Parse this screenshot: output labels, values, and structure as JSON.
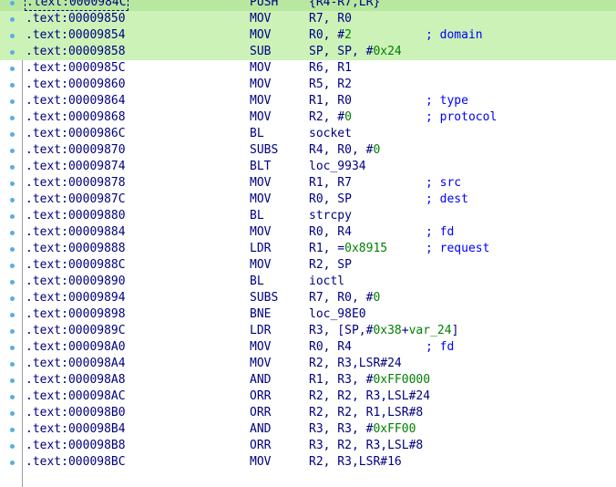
{
  "lines": [
    {
      "addr": ".text:0000984C",
      "mn": "PUSH",
      "ops": [
        {
          "t": "{R4-R7,LR}"
        }
      ],
      "cmt": "",
      "hl": "top",
      "sel": true
    },
    {
      "addr": ".text:00009850",
      "mn": "MOV",
      "ops": [
        {
          "t": "R7, R0"
        }
      ],
      "cmt": "",
      "hl": "yes"
    },
    {
      "addr": ".text:00009854",
      "mn": "MOV",
      "ops": [
        {
          "t": "R0, #"
        },
        {
          "t": "2",
          "n": true
        }
      ],
      "cmt": "; domain",
      "hl": "yes"
    },
    {
      "addr": ".text:00009858",
      "mn": "SUB",
      "ops": [
        {
          "t": "SP, SP, #"
        },
        {
          "t": "0x24",
          "n": true
        }
      ],
      "cmt": "",
      "hl": "yes"
    },
    {
      "addr": ".text:0000985C",
      "mn": "MOV",
      "ops": [
        {
          "t": "R6, R1"
        }
      ],
      "cmt": ""
    },
    {
      "addr": ".text:00009860",
      "mn": "MOV",
      "ops": [
        {
          "t": "R5, R2"
        }
      ],
      "cmt": ""
    },
    {
      "addr": ".text:00009864",
      "mn": "MOV",
      "ops": [
        {
          "t": "R1, R0"
        }
      ],
      "cmt": "; type"
    },
    {
      "addr": ".text:00009868",
      "mn": "MOV",
      "ops": [
        {
          "t": "R2, #"
        },
        {
          "t": "0",
          "n": true
        }
      ],
      "cmt": "; protocol"
    },
    {
      "addr": ".text:0000986C",
      "mn": "BL",
      "ops": [
        {
          "t": "socket"
        }
      ],
      "cmt": ""
    },
    {
      "addr": ".text:00009870",
      "mn": "SUBS",
      "ops": [
        {
          "t": "R4, R0, #"
        },
        {
          "t": "0",
          "n": true
        }
      ],
      "cmt": ""
    },
    {
      "addr": ".text:00009874",
      "mn": "BLT",
      "ops": [
        {
          "t": "loc_9934"
        }
      ],
      "cmt": ""
    },
    {
      "addr": ".text:00009878",
      "mn": "MOV",
      "ops": [
        {
          "t": "R1, R7"
        }
      ],
      "cmt": "; src"
    },
    {
      "addr": ".text:0000987C",
      "mn": "MOV",
      "ops": [
        {
          "t": "R0, SP"
        }
      ],
      "cmt": "; dest"
    },
    {
      "addr": ".text:00009880",
      "mn": "BL",
      "ops": [
        {
          "t": "strcpy"
        }
      ],
      "cmt": ""
    },
    {
      "addr": ".text:00009884",
      "mn": "MOV",
      "ops": [
        {
          "t": "R0, R4"
        }
      ],
      "cmt": "; fd"
    },
    {
      "addr": ".text:00009888",
      "mn": "LDR",
      "ops": [
        {
          "t": "R1, ="
        },
        {
          "t": "0x8915",
          "n": true
        }
      ],
      "cmt": "; request"
    },
    {
      "addr": ".text:0000988C",
      "mn": "MOV",
      "ops": [
        {
          "t": "R2, SP"
        }
      ],
      "cmt": ""
    },
    {
      "addr": ".text:00009890",
      "mn": "BL",
      "ops": [
        {
          "t": "ioctl"
        }
      ],
      "cmt": ""
    },
    {
      "addr": ".text:00009894",
      "mn": "SUBS",
      "ops": [
        {
          "t": "R7, R0, #"
        },
        {
          "t": "0",
          "n": true
        }
      ],
      "cmt": ""
    },
    {
      "addr": ".text:00009898",
      "mn": "BNE",
      "ops": [
        {
          "t": "loc_98E0"
        }
      ],
      "cmt": ""
    },
    {
      "addr": ".text:0000989C",
      "mn": "LDR",
      "ops": [
        {
          "t": "R3, [SP,#"
        },
        {
          "t": "0x38",
          "n": true
        },
        {
          "t": "+"
        },
        {
          "t": "var_24",
          "n": true
        },
        {
          "t": "]"
        }
      ],
      "cmt": ""
    },
    {
      "addr": ".text:000098A0",
      "mn": "MOV",
      "ops": [
        {
          "t": "R0, R4"
        }
      ],
      "cmt": "; fd"
    },
    {
      "addr": ".text:000098A4",
      "mn": "MOV",
      "ops": [
        {
          "t": "R2, R3,LSR#24"
        }
      ],
      "cmt": ""
    },
    {
      "addr": ".text:000098A8",
      "mn": "AND",
      "ops": [
        {
          "t": "R1, R3, #"
        },
        {
          "t": "0xFF0000",
          "n": true
        }
      ],
      "cmt": ""
    },
    {
      "addr": ".text:000098AC",
      "mn": "ORR",
      "ops": [
        {
          "t": "R2, R2, R3,LSL#24"
        }
      ],
      "cmt": ""
    },
    {
      "addr": ".text:000098B0",
      "mn": "ORR",
      "ops": [
        {
          "t": "R2, R2, R1,LSR#8"
        }
      ],
      "cmt": ""
    },
    {
      "addr": ".text:000098B4",
      "mn": "AND",
      "ops": [
        {
          "t": "R3, R3, #"
        },
        {
          "t": "0xFF00",
          "n": true
        }
      ],
      "cmt": ""
    },
    {
      "addr": ".text:000098B8",
      "mn": "ORR",
      "ops": [
        {
          "t": "R3, R2, R3,LSL#8"
        }
      ],
      "cmt": ""
    },
    {
      "addr": ".text:000098BC",
      "mn": "MOV",
      "ops": [
        {
          "t": "R2, R3,LSR#16"
        }
      ],
      "cmt": ""
    }
  ],
  "colors": {
    "text": "#000080",
    "number": "#008000",
    "comment": "#0000ff",
    "highlight": "#ccf2b8",
    "highlight_top": "#b8e8a0",
    "breakpoint_dot": "#5aaee0"
  }
}
